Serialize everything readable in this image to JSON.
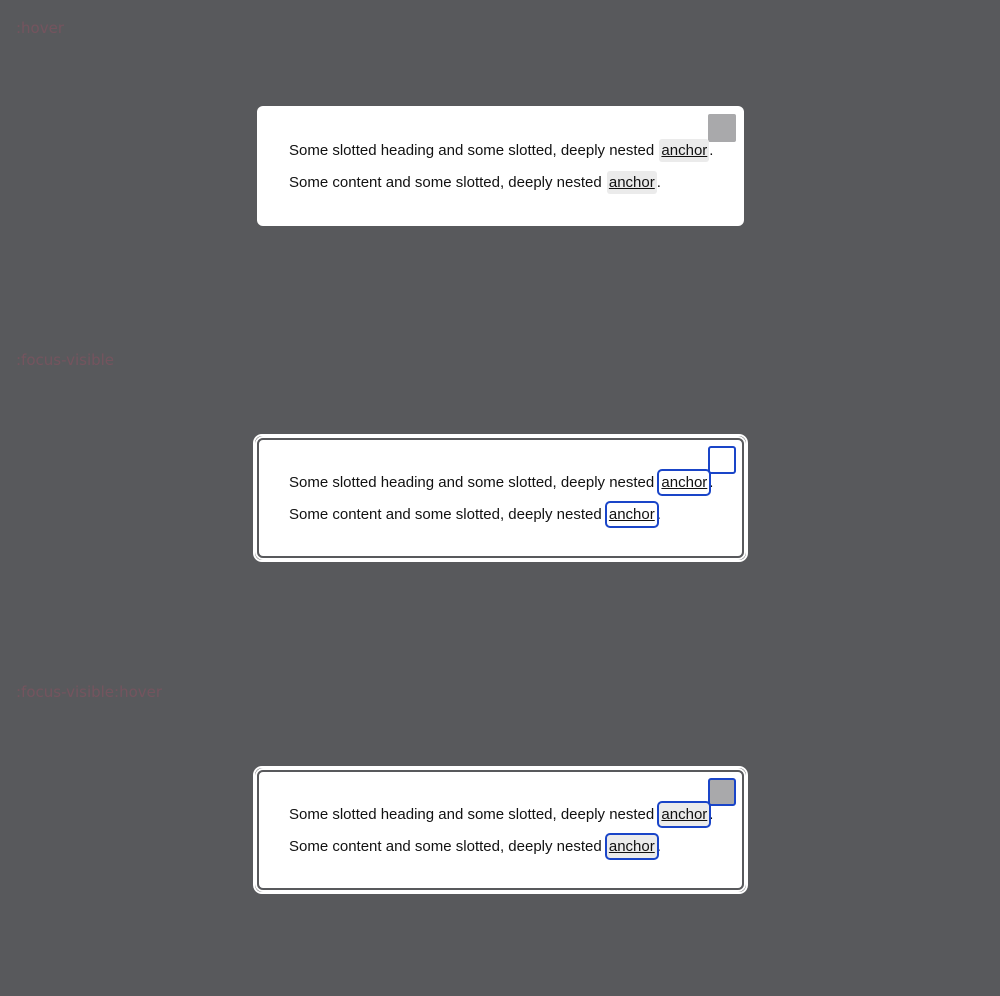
{
  "states": [
    {
      "label": ":hover",
      "heading_text": "Some slotted heading and some slotted, deeply nested ",
      "content_text": "Some content and some slotted, deeply nested ",
      "anchor_label": "anchor",
      "suffix": "."
    },
    {
      "label": ":focus-visible",
      "heading_text": "Some slotted heading and some slotted, deeply nested ",
      "content_text": "Some content and some slotted, deeply nested ",
      "anchor_label": "anchor",
      "suffix": "."
    },
    {
      "label": ":focus-visible:hover",
      "heading_text": "Some slotted heading and some slotted, deeply nested ",
      "content_text": "Some content and some slotted, deeply nested ",
      "anchor_label": "anchor",
      "suffix": "."
    }
  ],
  "colors": {
    "background": "#58595c",
    "focus_ring": "#1a45c8",
    "hover_fill": "#ebebeb",
    "dismiss_hover": "#a9a9ab"
  }
}
